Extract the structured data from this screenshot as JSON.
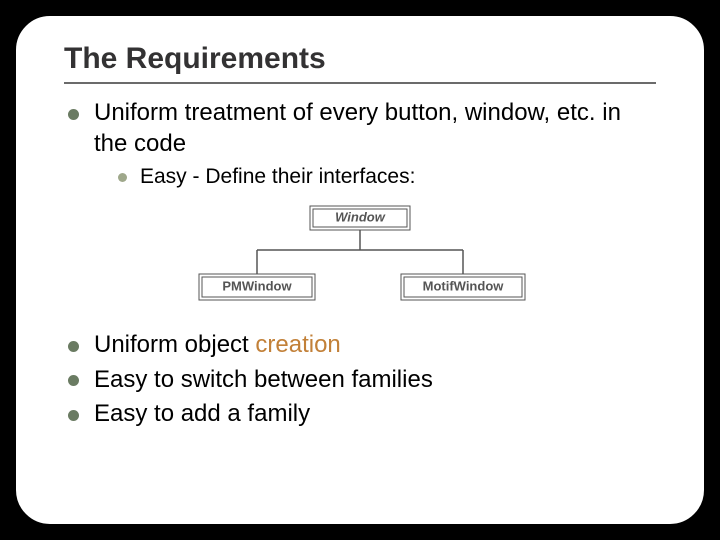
{
  "slide": {
    "title": "The Requirements",
    "bullets": {
      "b1": {
        "text": "Uniform treatment of every button, window, etc. in the code"
      },
      "b1_sub1": {
        "text": "Easy - Define their interfaces:"
      },
      "b2_pre": "Uniform object ",
      "b2_hl": "creation",
      "b3": {
        "text": "Easy to switch between families"
      },
      "b4": {
        "text": "Easy to add a family"
      }
    },
    "diagram": {
      "parent": "Window",
      "child_left": "PMWindow",
      "child_right": "MotifWindow"
    }
  }
}
